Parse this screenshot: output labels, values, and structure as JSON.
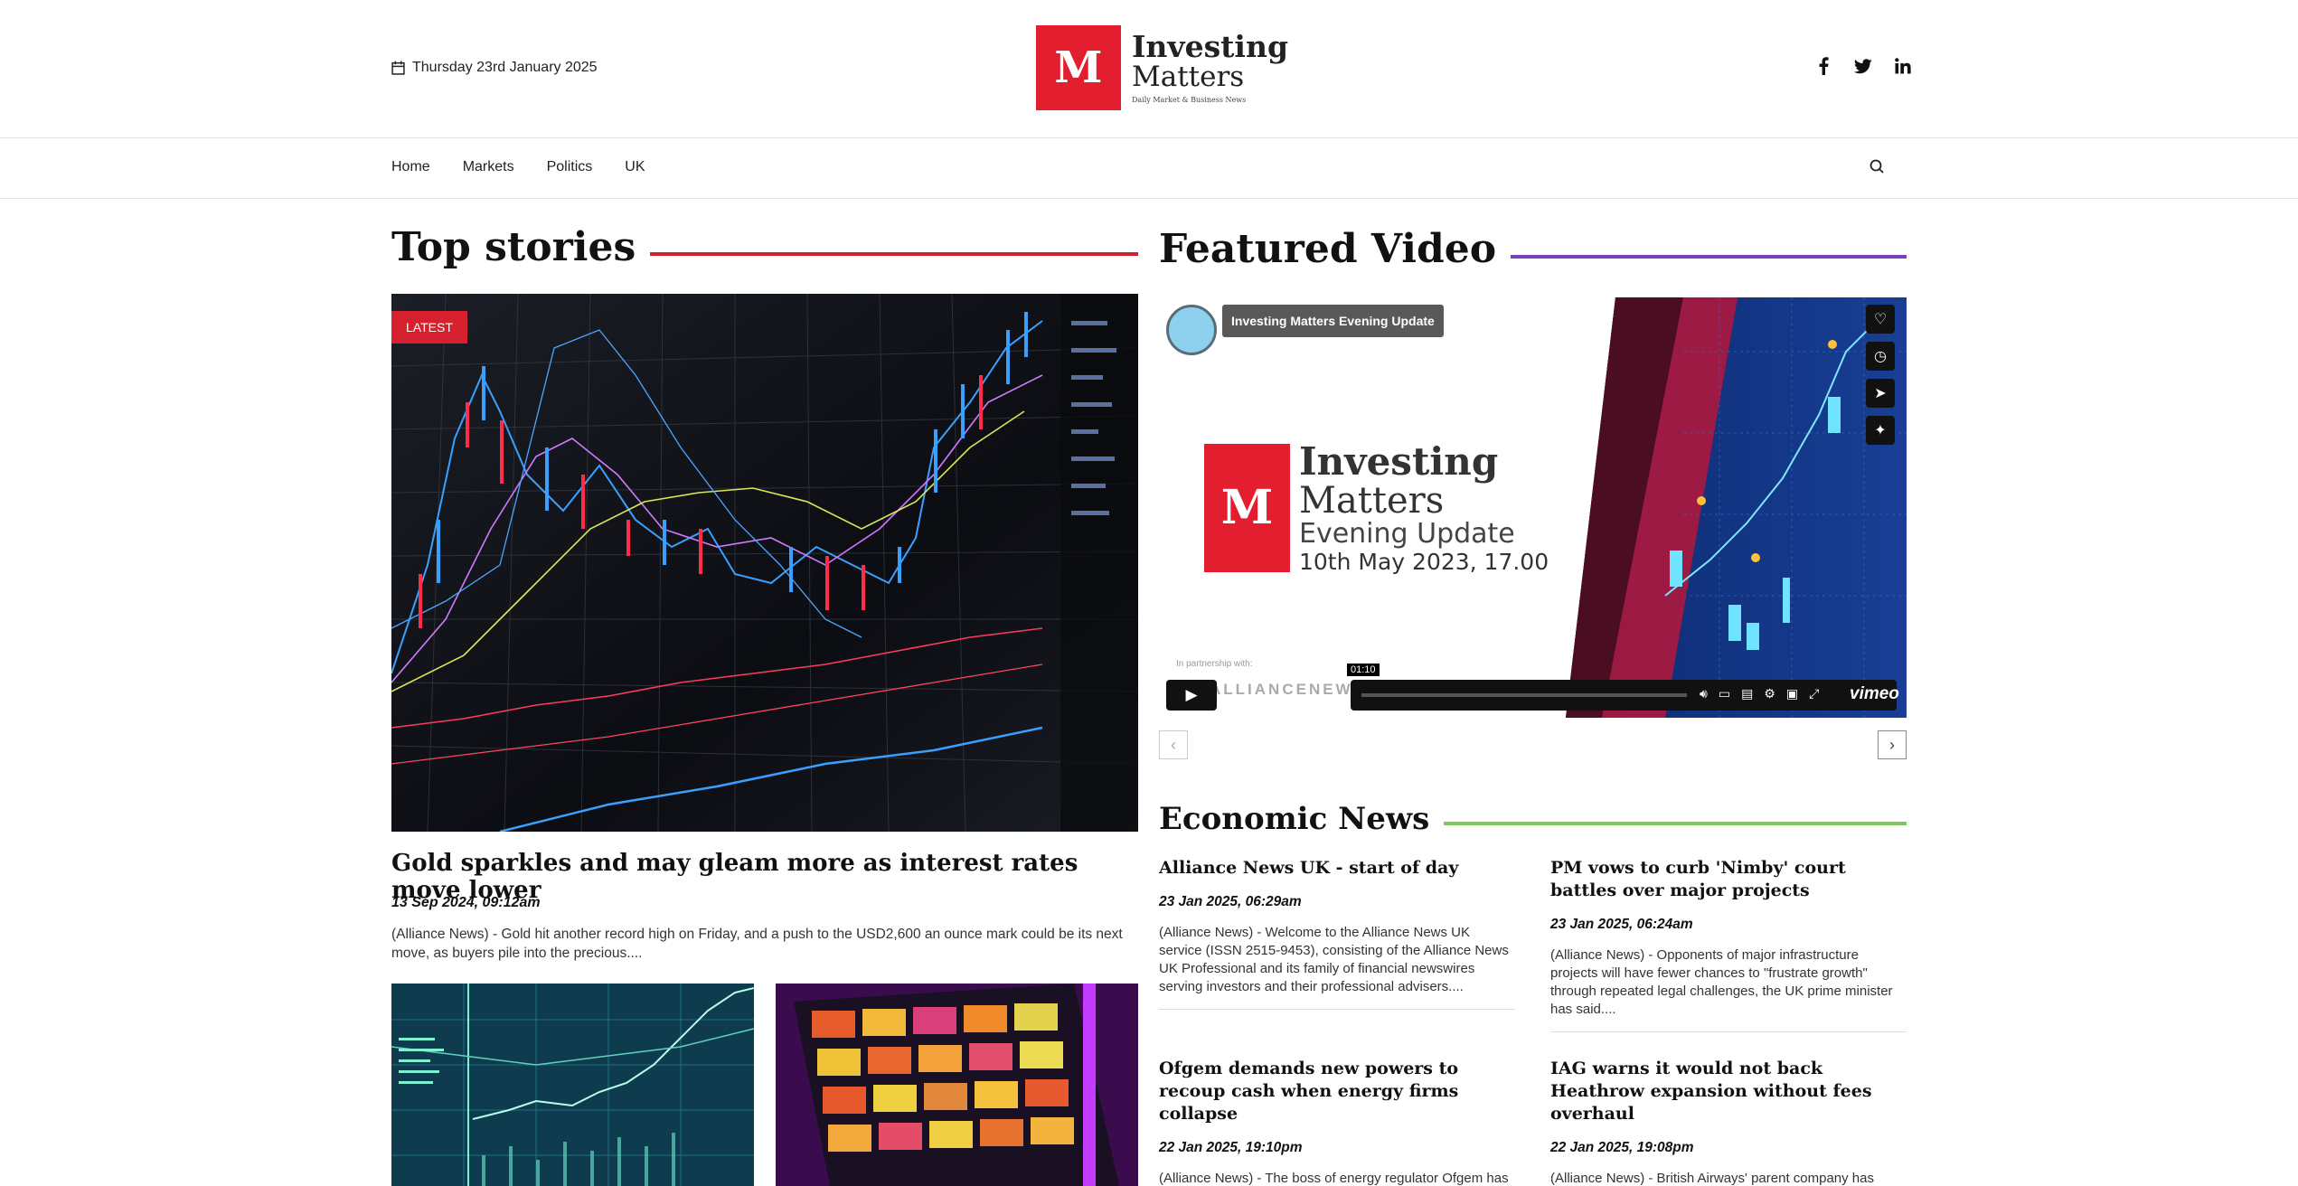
{
  "header": {
    "date": "Thursday 23rd January 2025",
    "logo": {
      "mark": "M",
      "line1": "Investing",
      "line2": "Matters",
      "tagline": "Daily Market & Business News"
    },
    "social": [
      {
        "name": "facebook-icon",
        "glyph": "f"
      },
      {
        "name": "twitter-icon",
        "glyph": "t"
      },
      {
        "name": "linkedin-icon",
        "glyph": "in"
      }
    ]
  },
  "nav": {
    "items": [
      "Home",
      "Markets",
      "Politics",
      "UK"
    ],
    "search_icon": "search-icon"
  },
  "top_stories": {
    "title": "Top stories",
    "rule_color": "#d6202e",
    "badge": "LATEST",
    "headline": "Gold sparkles and may gleam more as interest rates move lower",
    "date": "13 Sep 2024, 09:12am",
    "excerpt": "(Alliance News) - Gold hit another record high on Friday, and a push to the USD2,600 an ounce mark could be its next move, as buyers pile into the precious...."
  },
  "featured_video": {
    "title": "Featured Video",
    "rule_color": "#7b3fb8",
    "video_title": "Investing Matters Evening Update",
    "card": {
      "mark": "M",
      "line1": "Investing",
      "line2": "Matters",
      "line3": "Evening Update",
      "line4": "10th May 2023, 17.00"
    },
    "partner": "In partnership with:",
    "partner_name": "ALLIANCENEWS",
    "time": "01:10",
    "player_brand": "vimeo",
    "prev": "‹",
    "next": "›"
  },
  "economic_news": {
    "title": "Economic News",
    "rule_color": "#7cc95a",
    "items": [
      {
        "headline": "Alliance News UK - start of day",
        "date": "23 Jan 2025, 06:29am",
        "excerpt": "(Alliance News) - Welcome to the Alliance News UK service (ISSN 2515-9453), consisting of the Alliance News UK Professional and its family of financial newswires serving investors and their professional advisers...."
      },
      {
        "headline": "PM vows to curb 'Nimby' court battles over major projects",
        "date": "23 Jan 2025, 06:24am",
        "excerpt": "(Alliance News) - Opponents of major infrastructure projects will have fewer chances to \"frustrate growth\" through repeated legal challenges, the UK prime minister has said...."
      },
      {
        "headline": "Ofgem demands new powers to recoup cash when energy firms collapse",
        "date": "22 Jan 2025, 19:10pm",
        "excerpt": "(Alliance News) - The boss of energy regulator Ofgem has called for more powers to make sure customers rather"
      },
      {
        "headline": "IAG warns it would not back Heathrow expansion without fees overhaul",
        "date": "22 Jan 2025, 19:08pm",
        "excerpt": "(Alliance News) - British Airways' parent company has warned it would not support Heathrow expansion"
      }
    ]
  }
}
